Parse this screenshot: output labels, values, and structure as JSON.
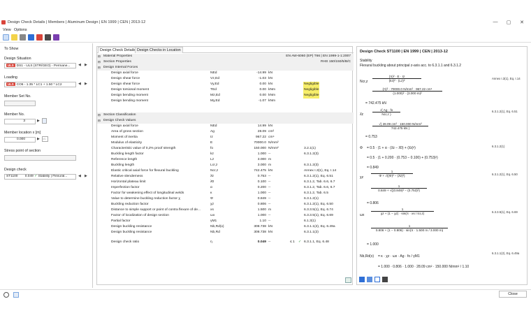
{
  "window": {
    "title": "Design Check Details | Members | Aluminum Design | EN 1999 | CEN | 2013-12",
    "minimize": "—",
    "restore": "▢",
    "close": "✕"
  },
  "menu": [
    "View",
    "Options"
  ],
  "left": {
    "to_show": "To Show",
    "design_situation_label": "Design Situation",
    "design_situation_tag": "ULS",
    "design_situation_value": "DS1 - ULS (STR/GEO) - Permane...",
    "loading_label": "Loading",
    "loading_tag": "ULS",
    "loading_value": "CO6 - 1.35 * LC1 + 1.50 * LC2",
    "member_set_label": "Member Set No.",
    "member_label": "Member No.",
    "member_value": "3",
    "location_label": "Member location x [m]",
    "location_value": "0.000",
    "stress_point_label": "Stress point of section",
    "design_check_label": "Design check",
    "design_check_id": "ST1100",
    "design_check_ratio": "0.049",
    "design_check_desc": "Stability | Flexural..."
  },
  "center": {
    "tabs": [
      "Design Check Details",
      "Design Checks in Location"
    ],
    "sec_material": "Material Properties",
    "material_value": "EN AW-6060 (EP) T66 | EN 1999-1-1:2007",
    "sec_section": "Section Properties",
    "section_value": "RHS 150/150/5/B/C",
    "sec_internal": "Design Internal Forces",
    "internal": [
      {
        "name": "Design axial force",
        "sym": "NEd",
        "val": "-14.99",
        "unit": "kN",
        "note": ""
      },
      {
        "name": "Design shear force",
        "sym": "Vz,Ed",
        "val": "-1.03",
        "unit": "kN",
        "note": ""
      },
      {
        "name": "Design shear force",
        "sym": "Vy,Ed",
        "val": "0.00",
        "unit": "kN",
        "note": "Negligible"
      },
      {
        "name": "Design torsional moment",
        "sym": "TEd",
        "val": "0.00",
        "unit": "kNm",
        "note": "Negligible"
      },
      {
        "name": "Design bending moment",
        "sym": "Mz,Ed",
        "val": "0.00",
        "unit": "kNm",
        "note": "Negligible"
      },
      {
        "name": "Design bending moment",
        "sym": "My,Ed",
        "val": "-1.07",
        "unit": "kNm",
        "note": ""
      }
    ],
    "sec_classification": "Section Classification",
    "sec_values": "Design Check Values",
    "values": [
      {
        "name": "Design axial force",
        "sym": "NEd",
        "val": "14.99",
        "unit": "kN",
        "ref": ""
      },
      {
        "name": "Area of gross section",
        "sym": "Ag",
        "val": "28.09",
        "unit": "cm²",
        "ref": ""
      },
      {
        "name": "Moment of inertia",
        "sym": "Iz",
        "val": "967.22",
        "unit": "cm⁴",
        "ref": ""
      },
      {
        "name": "Modulus of elasticity",
        "sym": "E",
        "val": "70000.0",
        "unit": "N/mm²",
        "ref": ""
      },
      {
        "name": "Characteristic value of 0,2% proof strength",
        "sym": "fo",
        "val": "150.000",
        "unit": "N/mm²",
        "ref": "3.2.1(1)"
      },
      {
        "name": "Buckling length factor",
        "sym": "kz",
        "val": "1.000",
        "unit": "--",
        "ref": "6.3.1.2(3)"
      },
      {
        "name": "Reference length",
        "sym": "Lz",
        "val": "3.000",
        "unit": "m",
        "ref": ""
      },
      {
        "name": "Buckling length",
        "sym": "Lcr,z",
        "val": "3.000",
        "unit": "m",
        "ref": "6.3.1.2(3)"
      },
      {
        "name": "Elastic critical axial force for flexural buckling",
        "sym": "Ncr,z",
        "val": "742.475",
        "unit": "kN",
        "ref": "Annex I.3(1), Eq. I.14"
      },
      {
        "name": "Relative slenderness",
        "sym": "λ̄z",
        "val": "0.753",
        "unit": "--",
        "ref": "6.3.1.2(1), Eq. 6.51"
      },
      {
        "name": "Horizontal plateau limit",
        "sym": "λ̄0",
        "val": "0.100",
        "unit": "--",
        "ref": "6.3.1.2, Tab. 6.6, 6.7"
      },
      {
        "name": "Imperfection factor",
        "sym": "α",
        "val": "0.200",
        "unit": "--",
        "ref": "6.3.1.2, Tab. 6.6, 6.7"
      },
      {
        "name": "Factor for weakening effect of longitudinal welds",
        "sym": "κ",
        "val": "1.000",
        "unit": "--",
        "ref": "6.3.1.2, Tab. 6.5"
      },
      {
        "name": "Value to determine buckling reduction factor χ",
        "sym": "Φ",
        "val": "0.849",
        "unit": "--",
        "ref": "6.3.1.2(1)"
      },
      {
        "name": "Buckling reduction factor",
        "sym": "χz",
        "val": "0.806",
        "unit": "--",
        "ref": "6.3.1.2(1), Eq. 6.50"
      },
      {
        "name": "Distance to simple support or point of contra flexure of de...",
        "sym": "xs",
        "val": "1.500",
        "unit": "m",
        "ref": "6.3.3.5(1), Eq. 6.74"
      },
      {
        "name": "Factor of localization of design section",
        "sym": "ωx",
        "val": "1.000",
        "unit": "--",
        "ref": "6.3.3.5(1), Eq. 6.69"
      },
      {
        "name": "Partial factor",
        "sym": "γM1",
        "val": "1.10",
        "unit": "--",
        "ref": "6.1.3(1)"
      },
      {
        "name": "Design buckling resistance",
        "sym": "Nb,Rd(x)",
        "val": "308.738",
        "unit": "kN",
        "ref": "6.3.1.1(2), Eq. 6.49a"
      },
      {
        "name": "Design buckling resistance",
        "sym": "Nb,Rd",
        "val": "308.738",
        "unit": "kN",
        "ref": "6.3.1.1(2)"
      }
    ],
    "ratio": {
      "name": "Design check ratio",
      "sym": "η",
      "val": "0.049",
      "unit": "--",
      "limit": "≤ 1",
      "ok": "✓",
      "ref": "6.3.1.1, Eq. 6.48"
    }
  },
  "right": {
    "title": "Design Check ST1100 | EN 1999 | CEN | 2013-12",
    "subtitle": "Stability",
    "desc": "Flexural buckling about principal z-axis acc. to 6.3.1.1 and 6.3.1.2",
    "ncr_sym": "Ncr,z",
    "ncr_result": "742.475 kN",
    "ncr_ref": "Annex I.3(1), Eq. I.14",
    "lambda_sym": "λ̄z",
    "lambda_result": "0.753",
    "lambda_ref": "6.3.1.2(1), Eq. 6.51",
    "phi_sym": "Φ",
    "phi_result": "0.849",
    "phi_ref": "6.3.1.2(1)",
    "chi_sym": "χz",
    "chi_result": "0.806",
    "chi_ref": "6.3.1.2(1), Eq. 6.50",
    "omega_sym": "ωx",
    "omega_result": "1.000",
    "omega_ref": "6.3.3.5(1), Eq. 6.69",
    "nb_sym": "Nb,Rd(x)",
    "nb_ref": "6.3.1.1(2), Eq. 6.49a"
  },
  "footer": {
    "close": "Close"
  },
  "colors": {
    "tag_red": "#d9453b",
    "negligible_yellow": "#f7ee6a",
    "ok_green": "#2e9b3a",
    "toolbar_blue": "#2f6fd6"
  }
}
